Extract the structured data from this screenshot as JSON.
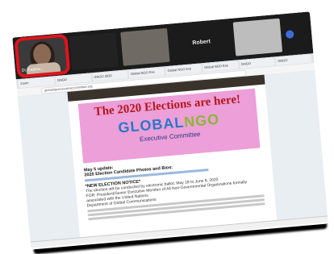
{
  "zoom": {
    "participants": [
      {
        "label": "Dr. Fatima...",
        "highlighted": true
      },
      {
        "label": ""
      },
      {
        "label": ""
      },
      {
        "label": "Robert"
      },
      {
        "label": ""
      }
    ]
  },
  "browser": {
    "tabs": [
      "Zoom",
      "GNGO",
      "GNGO 2020",
      "Global NGO Exe",
      "Global NGO Exe",
      "Global NGO Exe",
      "GNGO",
      "GNGO"
    ],
    "address": "globalngoexecutivecommittee.org"
  },
  "document": {
    "banner_title": "The 2020 Elections are here!",
    "logo_part1": "GLOBAL",
    "logo_part2": "NGO",
    "logo_sub": "Executive Committee",
    "update_heading": "May 5 update:",
    "update_sub": "2020 Election Candidate Photos and Bios:",
    "notice_heading": "*NEW ELECTION NOTICE*",
    "notice_line1": "The election will be conducted by electronic ballot: May 18 to June 8, 2020",
    "notice_line2": "FOR: President/Senior Executive Member of All Non-Governmental Organizations formally associated with the United Nations",
    "notice_line3": "Department of Global Communications"
  },
  "colors": {
    "highlight": "#e0141c",
    "banner": "#ec9fd8",
    "title_red": "#b5171a",
    "logo_blue": "#2979c8",
    "logo_green": "#8ab833"
  }
}
